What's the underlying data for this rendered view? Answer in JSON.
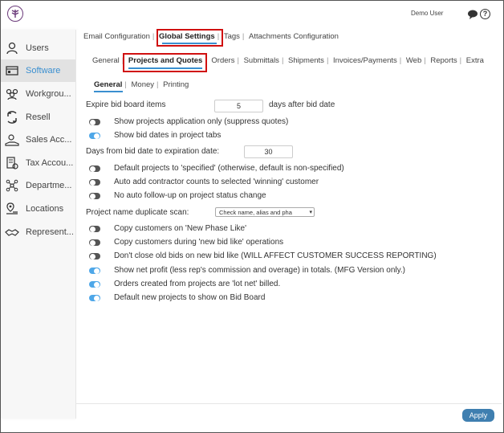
{
  "header": {
    "user": "Demo User"
  },
  "sidebar": {
    "items": [
      {
        "label": "Users",
        "icon": "user-icon"
      },
      {
        "label": "Software",
        "icon": "software-icon"
      },
      {
        "label": "Workgrou...",
        "icon": "workgroup-icon"
      },
      {
        "label": "Resell",
        "icon": "resell-icon"
      },
      {
        "label": "Sales Acc...",
        "icon": "sales-accounts-icon"
      },
      {
        "label": "Tax Accou...",
        "icon": "tax-accounts-icon"
      },
      {
        "label": "Departme...",
        "icon": "departments-icon"
      },
      {
        "label": "Locations",
        "icon": "locations-icon"
      },
      {
        "label": "Represent...",
        "icon": "representatives-icon"
      }
    ]
  },
  "tabs_top": [
    "Email Configuration",
    "Global Settings",
    "Tags",
    "Attachments Configuration"
  ],
  "tabs_mid": [
    "General",
    "Projects and Quotes",
    "Orders",
    "Submittals",
    "Shipments",
    "Invoices/Payments",
    "Web",
    "Reports",
    "Extra"
  ],
  "tabs_sub": [
    "General",
    "Money",
    "Printing"
  ],
  "settings": {
    "expire_label": "Expire bid board items",
    "expire_value": "5",
    "expire_suffix": "days after bid date",
    "s1": "Show projects application only (suppress quotes)",
    "s2": "Show bid dates in project tabs",
    "days_label": "Days from bid date to expiration date:",
    "days_value": "30",
    "s3": "Default projects to 'specified' (otherwise, default is non-specified)",
    "s4": "Auto add contractor counts to selected 'winning' customer",
    "s5": "No auto follow-up on project status change",
    "dup_label": "Project name duplicate scan:",
    "dup_value": "Check name, alias and pha",
    "s6": "Copy customers on 'New Phase Like'",
    "s7": "Copy customers during 'new bid like' operations",
    "s8": "Don't close old bids on new bid like (WILL AFFECT CUSTOMER SUCCESS REPORTING)",
    "s9": "Show net profit (less rep's commission and overage) in totals. (MFG Version only.)",
    "s10": "Orders created from projects are 'lot net' billed.",
    "s11": "Default new projects to show on Bid Board"
  },
  "footer": {
    "apply": "Apply"
  },
  "colors": {
    "accent": "#3a8fd0",
    "highlight": "#d01010",
    "toggle_on": "#4ea7e8",
    "toggle_off": "#555555",
    "apply_bg": "#3f7fb0"
  }
}
